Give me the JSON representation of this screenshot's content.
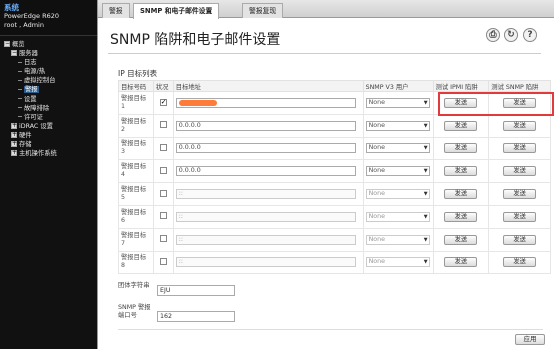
{
  "sidebar": {
    "title": "系统",
    "model": "PowerEdge R620",
    "user": "root , Admin",
    "tree": [
      {
        "label": "概览",
        "toggle": "−",
        "level": 0
      },
      {
        "label": "服务器",
        "toggle": "−",
        "level": 1
      },
      {
        "label": "日志",
        "level": 2
      },
      {
        "label": "电源/热",
        "level": 2
      },
      {
        "label": "虚拟控制台",
        "level": 2
      },
      {
        "label": "警报",
        "level": 2,
        "selected": true
      },
      {
        "label": "设置",
        "level": 2
      },
      {
        "label": "故障排除",
        "level": 2
      },
      {
        "label": "许可证",
        "level": 2
      },
      {
        "label": "iDRAC 设置",
        "toggle": "+",
        "level": 1
      },
      {
        "label": "硬件",
        "toggle": "+",
        "level": 1
      },
      {
        "label": "存储",
        "toggle": "+",
        "level": 1
      },
      {
        "label": "主机操作系统",
        "toggle": "+",
        "level": 1
      }
    ]
  },
  "tabs": [
    {
      "label": "警报",
      "active": false
    },
    {
      "label": "SNMP 和电子邮件设置",
      "active": true
    },
    {
      "label": "警报复现",
      "active": false
    }
  ],
  "page_title": "SNMP 陷阱和电子邮件设置",
  "toolbar_icons": [
    "print-icon",
    "refresh-icon",
    "help-icon"
  ],
  "section_label": "IP 目标列表",
  "table": {
    "headers": [
      "目标号码",
      "状况",
      "目标地址",
      "SNMP V3 用户",
      "测试 IPMI 陷阱",
      "测试 SNMP 陷阱"
    ],
    "rows": [
      {
        "name": "警报目标 1",
        "checked": true,
        "address": "",
        "redacted": true,
        "v3": "None",
        "ipmi": "发送",
        "snmp": "发送",
        "disabled": false
      },
      {
        "name": "警报目标 2",
        "checked": false,
        "address": "0.0.0.0",
        "v3": "None",
        "ipmi": "发送",
        "snmp": "发送",
        "disabled": false
      },
      {
        "name": "警报目标 3",
        "checked": false,
        "address": "0.0.0.0",
        "v3": "None",
        "ipmi": "发送",
        "snmp": "发送",
        "disabled": false
      },
      {
        "name": "警报目标 4",
        "checked": false,
        "address": "0.0.0.0",
        "v3": "None",
        "ipmi": "发送",
        "snmp": "发送",
        "disabled": false
      },
      {
        "name": "警报目标 5",
        "checked": false,
        "address": "::",
        "v3": "None",
        "ipmi": "发送",
        "snmp": "发送",
        "disabled": true
      },
      {
        "name": "警报目标 6",
        "checked": false,
        "address": "::",
        "v3": "None",
        "ipmi": "发送",
        "snmp": "发送",
        "disabled": true
      },
      {
        "name": "警报目标 7",
        "checked": false,
        "address": "::",
        "v3": "None",
        "ipmi": "发送",
        "snmp": "发送",
        "disabled": true
      },
      {
        "name": "警报目标 8",
        "checked": false,
        "address": "::",
        "v3": "None",
        "ipmi": "发送",
        "snmp": "发送",
        "disabled": true
      }
    ]
  },
  "community": {
    "label": "团体字符串",
    "value": "EJU"
  },
  "snmp_port": {
    "label": "SNMP 警报端口号",
    "value": "162"
  },
  "apply_label": "应用",
  "colors": {
    "highlight": "#e23a3a",
    "redaction": "#ff7b39",
    "selected_nav": "#2c5b8a",
    "title_blue": "#6ab0ff"
  }
}
